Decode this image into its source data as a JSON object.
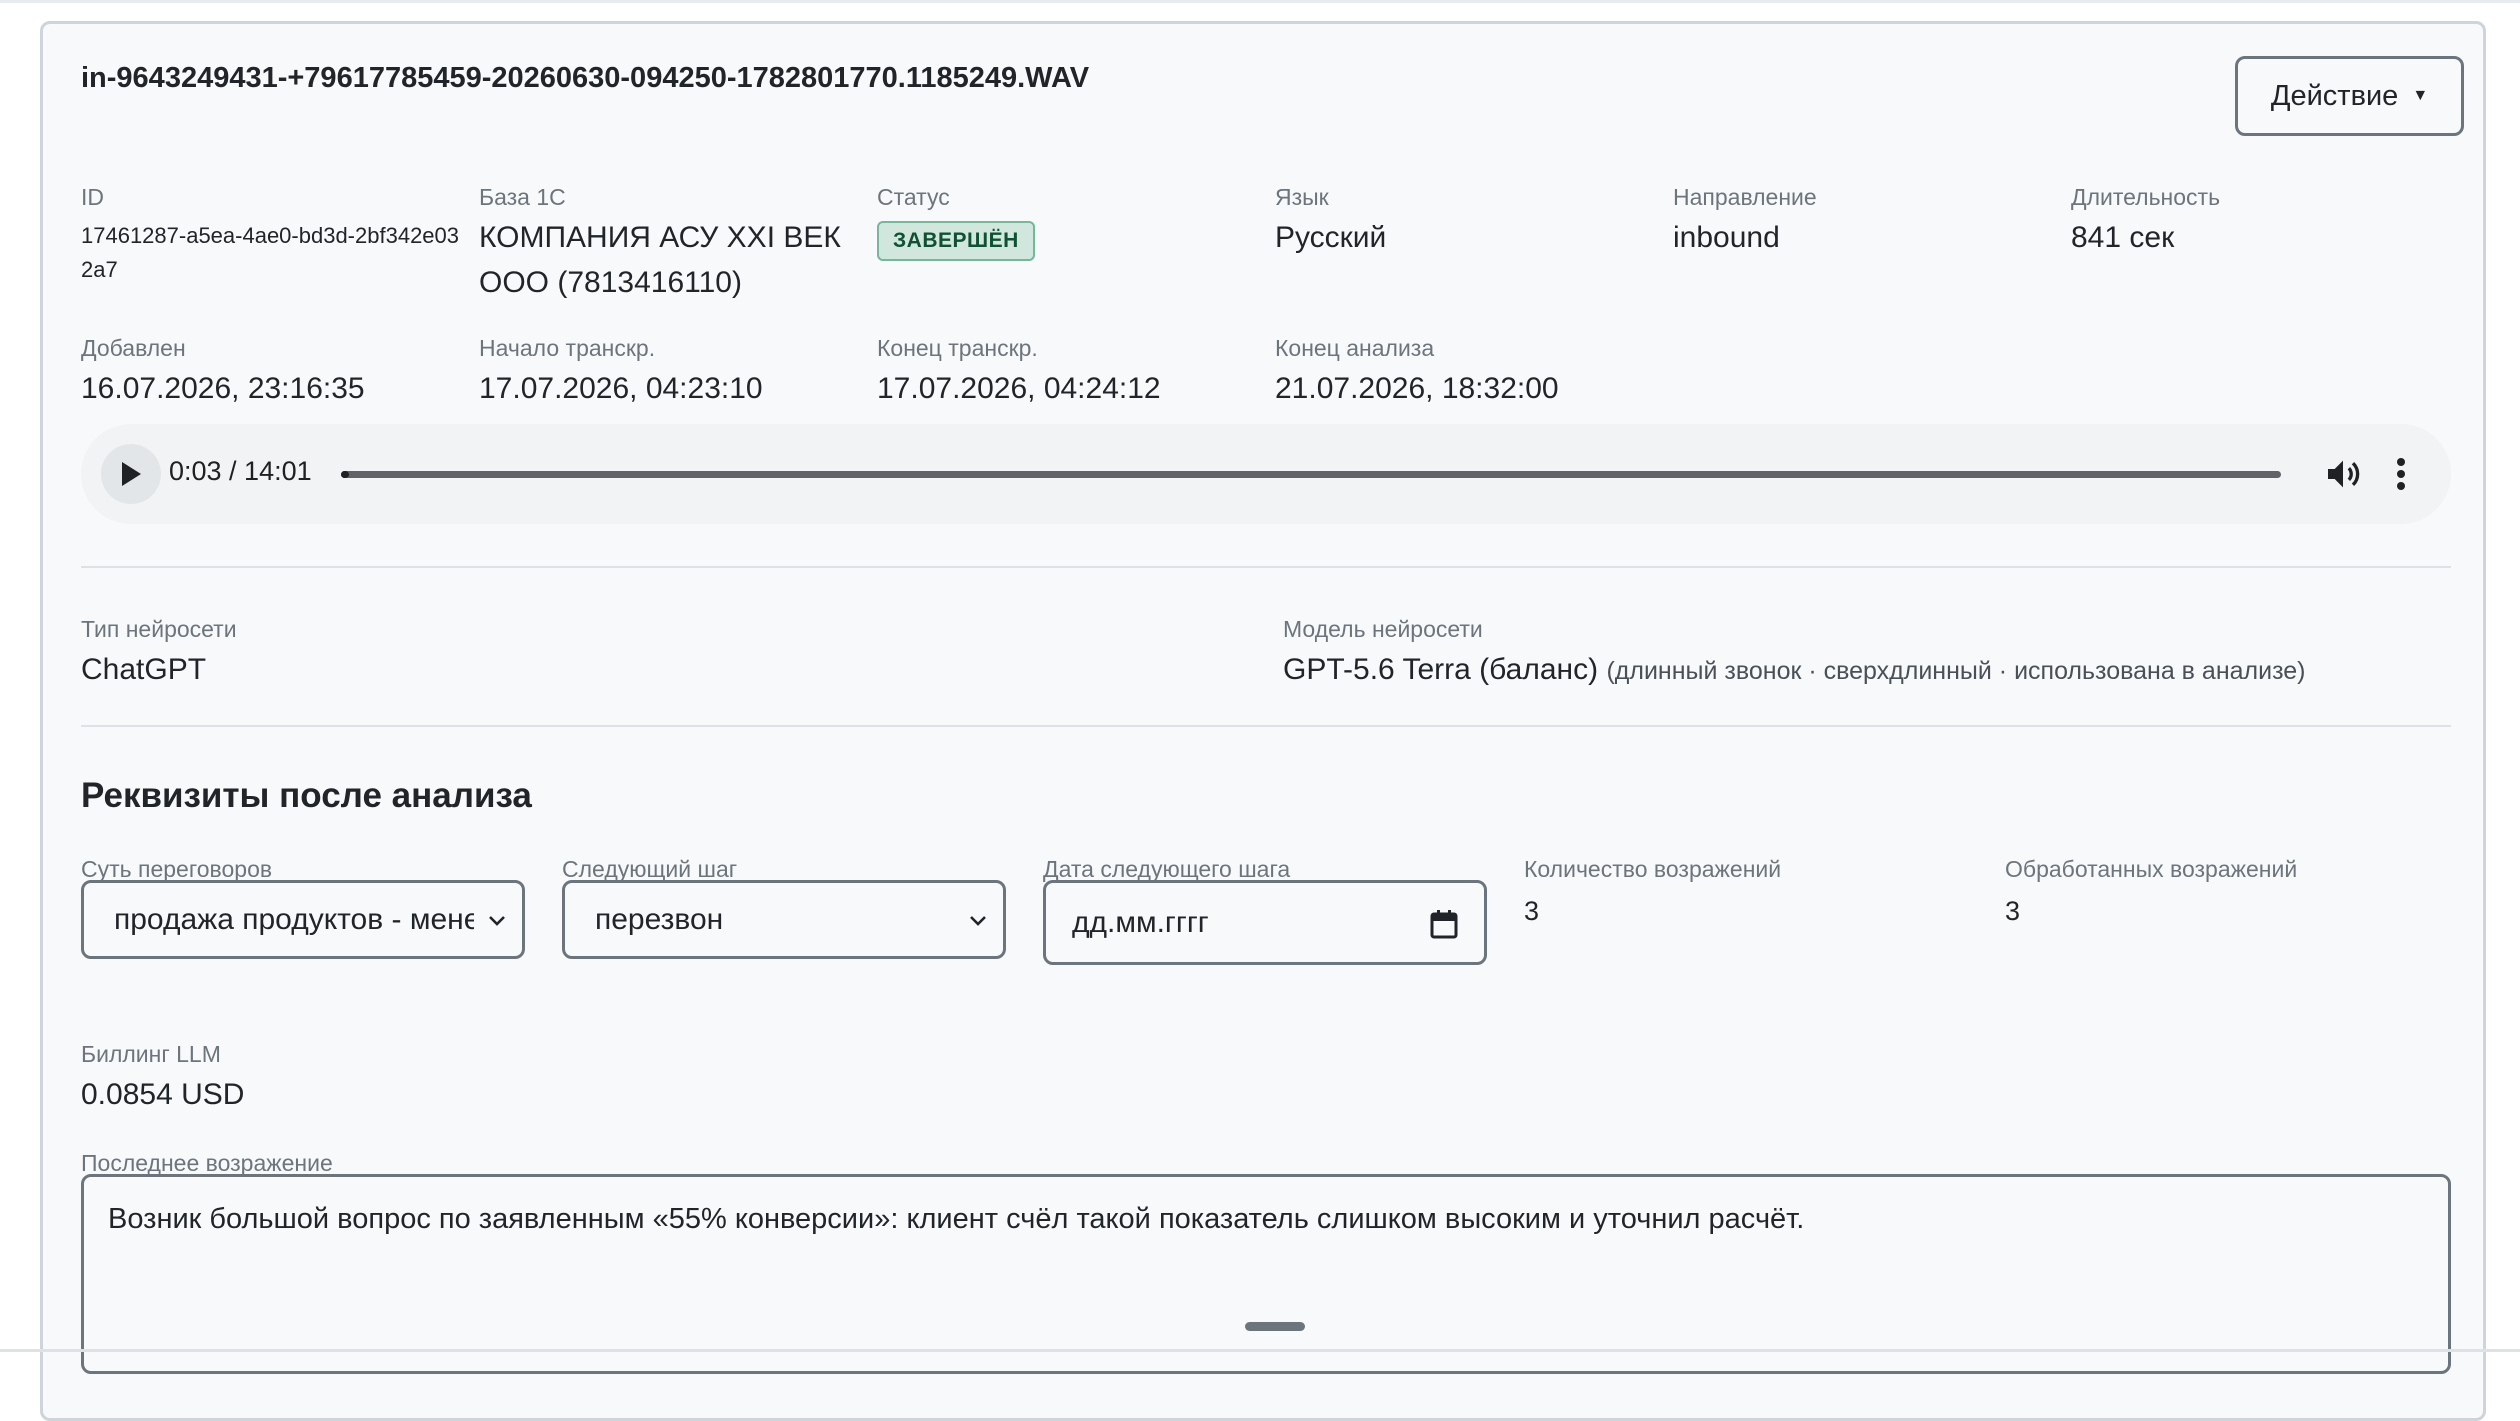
{
  "file": {
    "title": "in-9643249431-+79617785459-20260630-094250-1782801770.1185249.WAV",
    "action_label": "Действие"
  },
  "meta": {
    "id_label": "ID",
    "id_value": "17461287-a5ea-4ae0-bd3d-2bf342e032a7",
    "base_label": "База 1С",
    "base_value": "КОМПАНИЯ АСУ XXI ВЕК ООО (7813416110)",
    "status_label": "Статус",
    "status_value": "ЗАВЕРШЁН",
    "lang_label": "Язык",
    "lang_value": "Русский",
    "direction_label": "Направление",
    "direction_value": "inbound",
    "duration_label": "Длительность",
    "duration_value": "841 сек",
    "added_label": "Добавлен",
    "added_value": "16.07.2026, 23:16:35",
    "tr_start_label": "Начало транскр.",
    "tr_start_value": "17.07.2026, 04:23:10",
    "tr_end_label": "Конец транскр.",
    "tr_end_value": "17.07.2026, 04:24:12",
    "an_end_label": "Конец анализа",
    "an_end_value": "21.07.2026, 18:32:00"
  },
  "audio": {
    "time": "0:03 / 14:01",
    "progress_fraction": 0.0036
  },
  "ai": {
    "type_label": "Тип нейросети",
    "type_value": "ChatGPT",
    "model_label": "Модель нейросети",
    "model_value": "GPT-5.6 Terra (баланс)",
    "model_hint": "(длинный звонок · сверхдлинный · использована в анализе)"
  },
  "requisites": {
    "title": "Реквизиты после анализа",
    "essence_label": "Суть переговоров",
    "essence_value": "продажа продуктов - менеджер",
    "next_step_label": "Следующий шаг",
    "next_step_value": "перезвон",
    "next_date_label": "Дата следующего шага",
    "next_date_placeholder": "дд.мм.гггг",
    "objections_label": "Количество возражений",
    "objections_value": "3",
    "handled_label": "Обработанных возражений",
    "handled_value": "3",
    "billing_label": "Биллинг LLM",
    "billing_value": "0.0854 USD",
    "last_objection_label": "Последнее возражение",
    "last_objection_value": "Возник большой вопрос по заявленным «55% конверсии»: клиент счёл такой показатель слишком высоким и уточнил расчёт."
  },
  "colors": {
    "badge_bg": "#d1e7dd",
    "badge_text": "#0f5132",
    "card_border": "#ced4da",
    "muted_label": "#6c757d"
  },
  "icons": [
    "play-icon",
    "volume-icon",
    "more-vertical-icon",
    "chevron-down-icon",
    "calendar-icon",
    "caret-down-icon",
    "resize-grip-icon"
  ]
}
